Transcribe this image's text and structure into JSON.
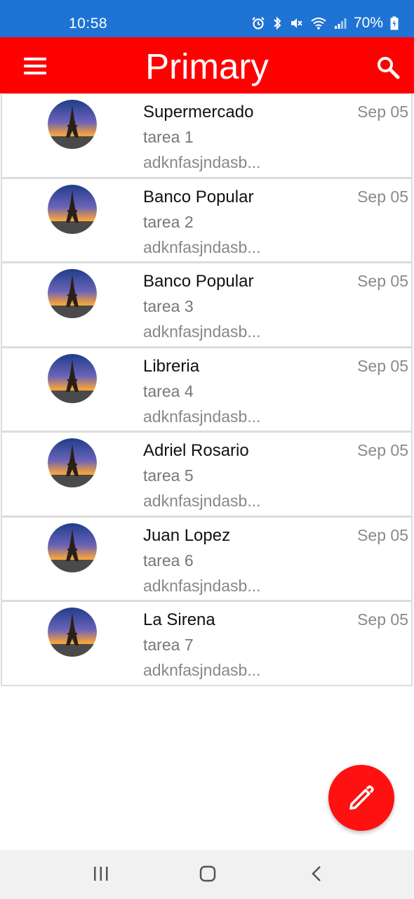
{
  "status": {
    "time": "10:58",
    "battery": "70%",
    "icons": [
      "alarm-icon",
      "bluetooth-icon",
      "mute-icon",
      "wifi-icon",
      "signal-icon",
      "battery-charging-icon"
    ]
  },
  "appbar": {
    "title": "Primary",
    "menu_icon": "hamburger-menu-icon",
    "search_icon": "search-icon",
    "color": "#ff0000"
  },
  "items": [
    {
      "title": "Supermercado",
      "date": "Sep 05",
      "subtitle": "tarea 1",
      "preview": "adknfasjndasb..."
    },
    {
      "title": "Banco Popular",
      "date": "Sep 05",
      "subtitle": "tarea 2",
      "preview": "adknfasjndasb..."
    },
    {
      "title": "Banco Popular",
      "date": "Sep 05",
      "subtitle": "tarea 3",
      "preview": "adknfasjndasb..."
    },
    {
      "title": "Libreria",
      "date": "Sep 05",
      "subtitle": "tarea 4",
      "preview": "adknfasjndasb..."
    },
    {
      "title": "Adriel Rosario",
      "date": "Sep 05",
      "subtitle": "tarea 5",
      "preview": "adknfasjndasb..."
    },
    {
      "title": "Juan Lopez",
      "date": "Sep 05",
      "subtitle": "tarea 6",
      "preview": "adknfasjndasb..."
    },
    {
      "title": "La Sirena",
      "date": "Sep 05",
      "subtitle": "tarea 7",
      "preview": "adknfasjndasb..."
    }
  ],
  "fab": {
    "icon": "pencil-icon",
    "color": "#ff1111"
  },
  "navbar": {
    "icons": [
      "recent-apps-icon",
      "home-icon",
      "back-icon"
    ]
  }
}
